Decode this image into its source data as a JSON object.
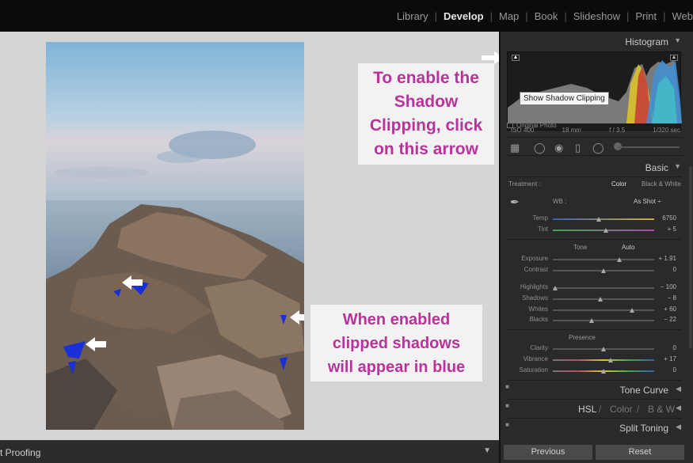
{
  "modules": [
    {
      "label": "Library",
      "active": false
    },
    {
      "label": "Develop",
      "active": true
    },
    {
      "label": "Map",
      "active": false
    },
    {
      "label": "Book",
      "active": false
    },
    {
      "label": "Slideshow",
      "active": false
    },
    {
      "label": "Print",
      "active": false
    },
    {
      "label": "Web",
      "active": false
    }
  ],
  "callouts": {
    "shadow_clipping": [
      "To enable the",
      "Shadow",
      "Clipping, click",
      "on this arrow"
    ],
    "blue_shadows": [
      "When enabled",
      "clipped shadows",
      "will appear in  blue"
    ]
  },
  "bottombar": {
    "label": "t Proofing"
  },
  "histogram": {
    "title": "Histogram",
    "tooltip": "Show Shadow Clipping",
    "exif": [
      "ISO 400",
      "18 mm",
      "f / 3.5",
      "1/320 sec"
    ],
    "original_label": "Original Photo"
  },
  "basic": {
    "title": "Basic",
    "treatment_label": "Treatment :",
    "treatment_options": [
      "Color",
      "Black & White"
    ],
    "wb_label": "WB :",
    "wb_value": "As Shot ÷",
    "tone_label": "Tone",
    "auto_label": "Auto",
    "presence_label": "Presence",
    "sliders": [
      {
        "name": "Temp",
        "value": "6750",
        "pos": 0.45
      },
      {
        "name": "Tint",
        "value": "+ 5",
        "pos": 0.52
      },
      {
        "name": "Exposure",
        "value": "+ 1.91",
        "pos": 0.66
      },
      {
        "name": "Contrast",
        "value": "0",
        "pos": 0.5
      },
      {
        "name": "Highlights",
        "value": "− 100",
        "pos": 0.02
      },
      {
        "name": "Shadows",
        "value": "− 8",
        "pos": 0.47
      },
      {
        "name": "Whites",
        "value": "+ 60",
        "pos": 0.78
      },
      {
        "name": "Blacks",
        "value": "− 22",
        "pos": 0.38
      },
      {
        "name": "Clarity",
        "value": "0",
        "pos": 0.5
      },
      {
        "name": "Vibrance",
        "value": "+ 17",
        "pos": 0.57
      },
      {
        "name": "Saturation",
        "value": "0",
        "pos": 0.5
      }
    ]
  },
  "panels": {
    "tone_curve": "Tone Curve",
    "hsl": [
      "HSL",
      "Color",
      "B & W"
    ],
    "split_toning": "Split Toning"
  },
  "buttons": {
    "previous": "Previous",
    "reset": "Reset"
  }
}
